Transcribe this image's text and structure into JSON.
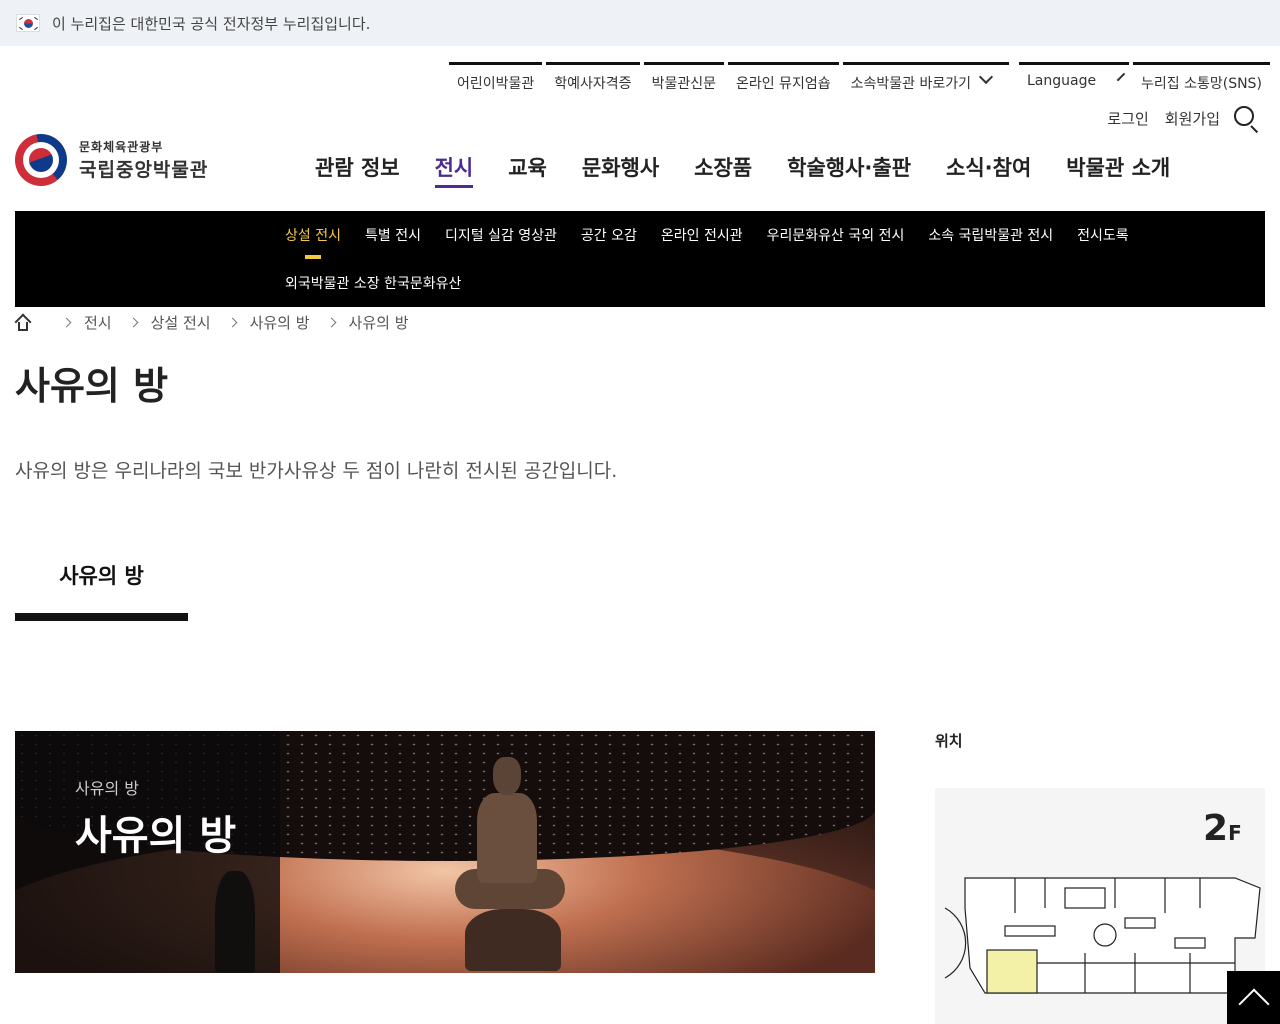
{
  "gov_banner": {
    "text": "이 누리집은 대한민국 공식 전자정부 누리집입니다."
  },
  "utility": {
    "links": [
      "어린이박물관",
      "학예사자격증",
      "박물관신문",
      "온라인 뮤지엄숍",
      "소속박물관 바로가기"
    ],
    "language": "Language",
    "sns": "누리집 소통망(SNS)",
    "login": "로그인",
    "signup": "회원가입"
  },
  "logo": {
    "ministry": "문화체육관광부",
    "name": "국립중앙박물관"
  },
  "gnb": [
    "관람 정보",
    "전시",
    "교육",
    "문화행사",
    "소장품",
    "학술행사·출판",
    "소식·참여",
    "박물관 소개"
  ],
  "gnb_active": "전시",
  "subnav": {
    "row1": [
      "상설 전시",
      "특별 전시",
      "디지털 실감 영상관",
      "공간 오감",
      "온라인 전시관",
      "우리문화유산 국외 전시",
      "소속 국립박물관 전시",
      "전시도록"
    ],
    "row2": "외국박물관 소장 한국문화유산",
    "active": "상설 전시"
  },
  "breadcrumb": [
    "전시",
    "상설 전시",
    "사유의 방",
    "사유의 방"
  ],
  "page": {
    "title": "사유의 방",
    "description": "사유의 방은 우리나라의 국보 반가사유상 두 점이 나란히 전시된 공간입니다.",
    "tab": "사유의 방"
  },
  "hero": {
    "kicker": "사유의 방",
    "title": "사유의 방"
  },
  "location": {
    "label": "위치",
    "floor": "2",
    "floor_suffix": "F"
  },
  "colors": {
    "accent": "#4b2c93",
    "highlight": "#f5c842",
    "subnav_bg": "#000000",
    "gov_bg": "#eef1f5"
  }
}
